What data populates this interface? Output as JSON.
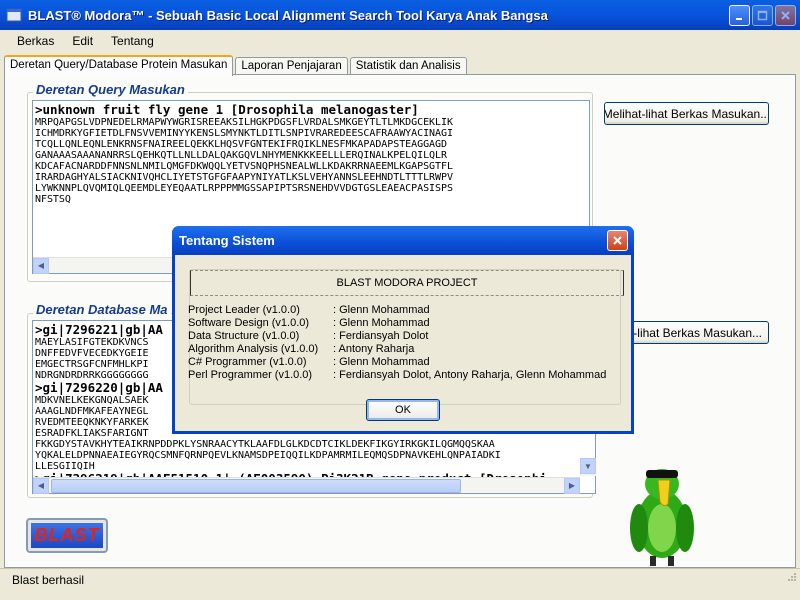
{
  "window": {
    "title": "BLAST® Modora™ - Sebuah Basic Local Alignment Search Tool Karya Anak Bangsa"
  },
  "menu": [
    "Berkas",
    "Edit",
    "Tentang"
  ],
  "tabs": [
    "Deretan Query/Database Protein Masukan",
    "Laporan Penjajaran",
    "Statistik dan Analisis"
  ],
  "query": {
    "label": "Deretan Query Masukan",
    "header": ">unknown fruit fly gene 1 [Drosophila melanogaster]",
    "lines": [
      "MRPQAPGSLVDPNEDELRMAPWYWGRISREEAKSILHGKPDGSFLVRDALSMKGEYTLTLMKDGCEKLIK",
      "ICHMDRKYGFIETDLFNSVVEMINYYKENSLSMYNKTLDITLSNPIVRAREDEESCAFRAAWYACINAGI",
      "TCQLLQNLEQNLENKRNSFNAIREELQEKKLHQSVFGNTEKIFRQIKLNESFMKAPADAPSTEAGGAGD",
      "GANAAASAAANANRRSLQEHKQTLLNLLDALQAKGQVLNHYMENKKKEELLLERQINALKPELQILQLR",
      "KDCAFACNARDDFNNSNLNMILQMGFDKWQQLYETVSNQPHSNEALWLLKDAKRRNAEEMLKGAPSGTFL",
      "IRARDAGHYALSIACKNIVQHCLIYETSTGFGFAAPYNIYATLKSLVEHYANNSLEEHNDTLTTTLRWPV",
      "LYWKNNPLQVQMIQLQEEMDLEYEQAATLRPPPMMGSSAPIPTSRSNEHDVVDGTGSLEAEACPASISPS",
      "NFSTSQ"
    ],
    "browse_button": "Melihat-lihat Berkas Masukan..."
  },
  "database": {
    "label": "Deretan Database Ma",
    "browse_button": "lihat-lihat Berkas Masukan...",
    "lines": [
      {
        "t": ">gi|7296221|gb|AA",
        "h": true
      },
      {
        "t": "MAEYLASIFGTEKDKVNCS",
        "h": false
      },
      {
        "t": "DNFFEDVFVECEDKYGEIE",
        "h": false
      },
      {
        "t": "EMGECTRSGFCNFMHLKPI",
        "h": false
      },
      {
        "t": "NDRGNDRDRRKGGGGGGGG",
        "h": false
      },
      {
        "t": ">gi|7296220|gb|AA",
        "h": true
      },
      {
        "t": "MDKVNELKEKGNQALSAEK",
        "h": false
      },
      {
        "t": "AAAGLNDFMKAFEAYNEGL",
        "h": false
      },
      {
        "t": "RVEDMTEEQKNKYFARKEK",
        "h": false
      },
      {
        "t": "ESRADFKLIAKSFARIGNT",
        "h": false
      },
      {
        "t": "FKKGDYSTAVKHYTEAIKRNPDDPKLYSNRAACYTKLAAFDLGLKDCDTCIKLDEKFIKGYIRKGKILQGMQQSKAA",
        "h": false
      },
      {
        "t": "YQKALELDPNNAEAIEGYRQCSMNFQRNPQEVLKNAMSDPEIQQILKDPAMRMILEQMQSDPNAVKEHLQNPAIADKI",
        "h": false
      },
      {
        "t": "LLESGIIQIH",
        "h": false
      },
      {
        "t": ">gi|7296219|gb|AAF51510.1| (AE003590) Pi3K21B gene product [Drosophi",
        "h": true
      }
    ]
  },
  "blast_button": "BLAST",
  "status": "Blast berhasil",
  "dialog": {
    "title": "Tentang Sistem",
    "project": "BLAST MODORA PROJECT",
    "credits": [
      {
        "role": "Project Leader (v1.0.0)",
        "name": ": Glenn Mohammad"
      },
      {
        "role": "Software Design (v1.0.0)",
        "name": ": Glenn Mohammad"
      },
      {
        "role": "Data Structure (v1.0.0)",
        "name": ": Ferdiansyah Dolot"
      },
      {
        "role": "Algorithm Analysis (v1.0.0)",
        "name": ": Antony Raharja"
      },
      {
        "role": "C# Programmer (v1.0.0)",
        "name": ": Glenn Mohammad"
      },
      {
        "role": "Perl Programmer (v1.0.0)",
        "name": ": Ferdiansyah Dolot, Antony Raharja, Glenn Mohammad"
      }
    ],
    "ok_button": "OK"
  },
  "colors": {
    "section_label": "#153b8b",
    "blast_text": "#e0261a",
    "titlebar": "#0855dd"
  },
  "icons": [
    "app-icon",
    "minimize-icon",
    "maximize-icon",
    "close-icon",
    "size-grip-icon",
    "parrot-mascot"
  ]
}
